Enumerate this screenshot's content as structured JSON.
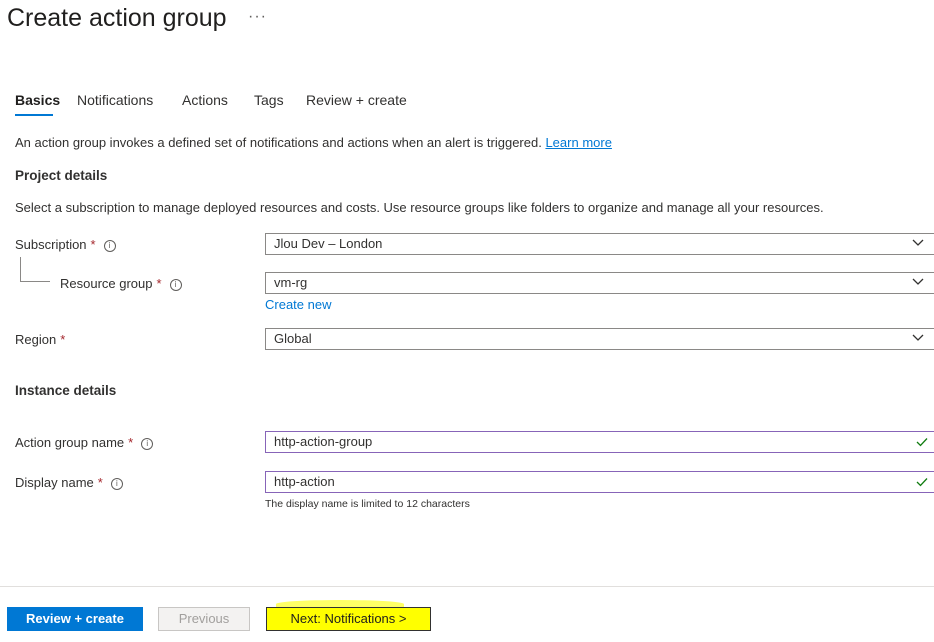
{
  "page": {
    "title": "Create action group",
    "more_label": "···"
  },
  "tabs": [
    {
      "label": "Basics"
    },
    {
      "label": "Notifications"
    },
    {
      "label": "Actions"
    },
    {
      "label": "Tags"
    },
    {
      "label": "Review + create"
    }
  ],
  "intro": {
    "text": "An action group invokes a defined set of notifications and actions when an alert is triggered.",
    "learn_more": "Learn more"
  },
  "project_details": {
    "heading": "Project details",
    "description": "Select a subscription to manage deployed resources and costs. Use resource groups like folders to organize and manage all your resources.",
    "subscription": {
      "label": "Subscription",
      "value": "Jlou Dev – London"
    },
    "resource_group": {
      "label": "Resource group",
      "value": "vm-rg",
      "create_new": "Create new"
    },
    "region": {
      "label": "Region",
      "value": "Global"
    }
  },
  "instance_details": {
    "heading": "Instance details",
    "action_group_name": {
      "label": "Action group name",
      "value": "http-action-group"
    },
    "display_name": {
      "label": "Display name",
      "value": "http-action",
      "hint": "The display name is limited to 12 characters"
    }
  },
  "required_marker": "*",
  "info_glyph": "i",
  "footer": {
    "review_create": "Review + create",
    "previous": "Previous",
    "next": "Next: Notifications >"
  },
  "colors": {
    "accent": "#0078d4",
    "required": "#a4262c",
    "valid_check": "#107c10",
    "highlight": "#ffff00"
  }
}
